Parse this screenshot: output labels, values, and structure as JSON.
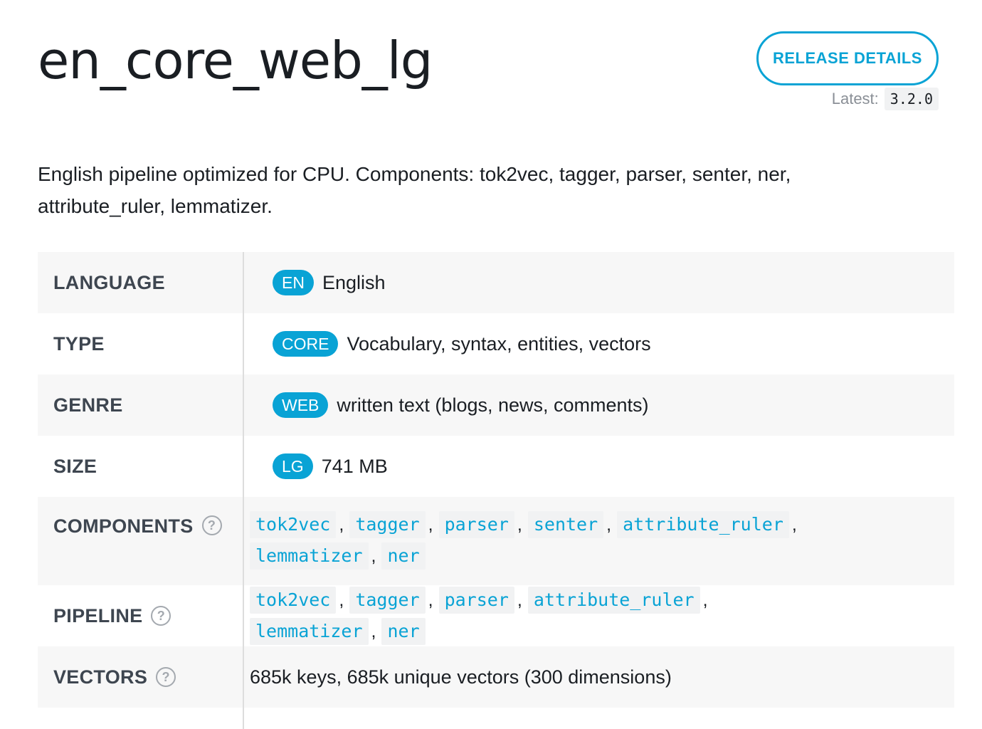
{
  "header": {
    "title": "en_core_web_lg",
    "release_button": "RELEASE DETAILS",
    "latest_label": "Latest:",
    "latest_version": "3.2.0"
  },
  "description": "English pipeline optimized for CPU. Components: tok2vec, tagger, parser, senter, ner, attribute_ruler, lemmatizer.",
  "table": {
    "language": {
      "label": "LANGUAGE",
      "tag": "EN",
      "value": "English"
    },
    "type": {
      "label": "TYPE",
      "tag": "CORE",
      "value": "Vocabulary, syntax, entities, vectors"
    },
    "genre": {
      "label": "GENRE",
      "tag": "WEB",
      "value": "written text (blogs, news, comments)"
    },
    "size": {
      "label": "SIZE",
      "tag": "LG",
      "value": "741 MB"
    },
    "components": {
      "label": "COMPONENTS",
      "items": [
        "tok2vec",
        "tagger",
        "parser",
        "senter",
        "attribute_ruler",
        "lemmatizer",
        "ner"
      ]
    },
    "pipeline": {
      "label": "PIPELINE",
      "items": [
        "tok2vec",
        "tagger",
        "parser",
        "attribute_ruler",
        "lemmatizer",
        "ner"
      ]
    },
    "vectors": {
      "label": "VECTORS",
      "value": "685k keys, 685k unique vectors (300 dimensions)"
    }
  },
  "icons": {
    "help": "question-circle-icon",
    "help_glyph": "?"
  },
  "colors": {
    "accent": "#09a3d5",
    "text": "#1a1e23",
    "label": "#3e4650",
    "stripe": "#f7f7f7",
    "chip_bg": "#f1f2f3"
  }
}
